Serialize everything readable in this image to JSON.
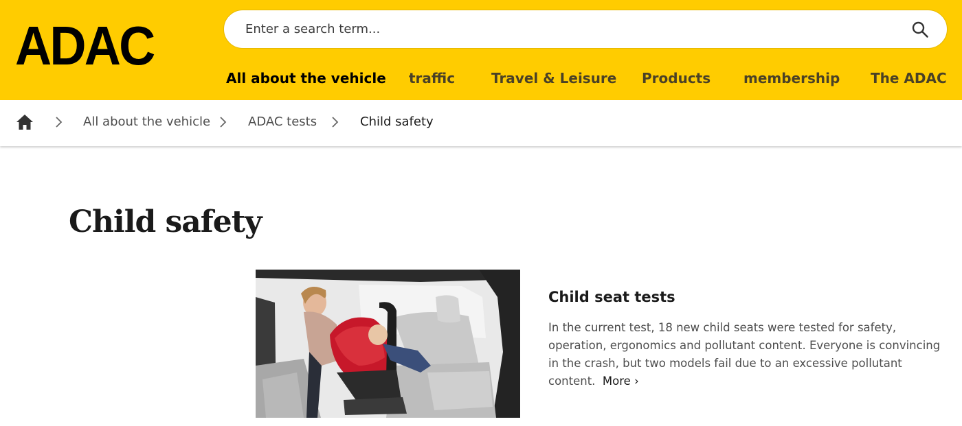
{
  "header": {
    "logo_text": "ADAC",
    "brand_color": "#ffcc00",
    "search": {
      "placeholder": "Enter a search term..."
    },
    "nav": [
      {
        "label": "All about the vehicle",
        "active": true
      },
      {
        "label": "traffic"
      },
      {
        "label": "Travel & Leisure"
      },
      {
        "label": "Products"
      },
      {
        "label": "membership"
      },
      {
        "label": "The ADAC"
      }
    ]
  },
  "breadcrumb": {
    "home_icon": "home-icon",
    "items": [
      {
        "label": "All about the vehicle"
      },
      {
        "label": "ADAC tests"
      },
      {
        "label": "Child safety",
        "current": true
      }
    ]
  },
  "main": {
    "title": "Child safety",
    "teaser": {
      "title": "Child seat tests",
      "text": "In the current test, 18 new child seats were tested for safety, operation, ergonomics and pollutant content. Everyone is convincing in the crash, but two models fail due to an excessive pollutant content.",
      "more_label": "More",
      "more_icon": "chevron-right-icon"
    }
  }
}
